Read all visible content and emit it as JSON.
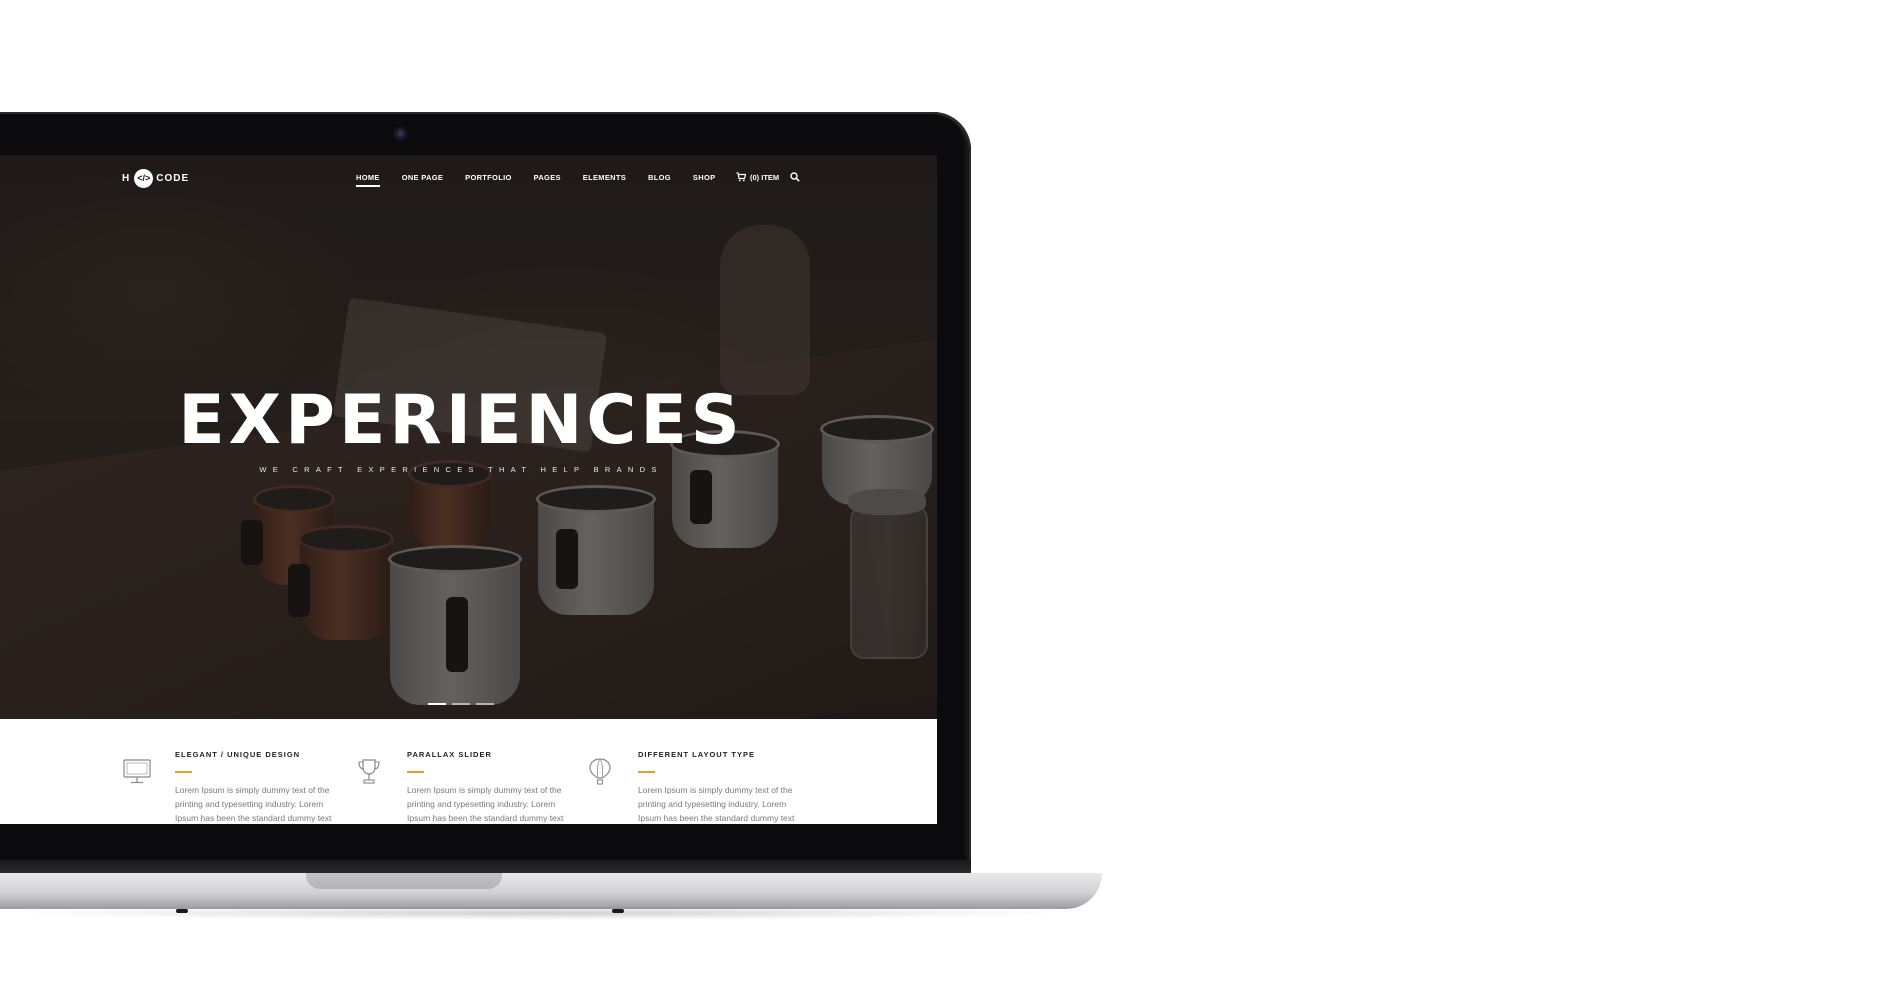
{
  "site": {
    "logo": {
      "left": "H",
      "mark": "</>",
      "right": "CODE"
    },
    "nav": [
      {
        "label": "HOME",
        "active": true
      },
      {
        "label": "ONE PAGE",
        "active": false
      },
      {
        "label": "PORTFOLIO",
        "active": false
      },
      {
        "label": "PAGES",
        "active": false
      },
      {
        "label": "ELEMENTS",
        "active": false
      },
      {
        "label": "BLOG",
        "active": false
      },
      {
        "label": "SHOP",
        "active": false
      }
    ],
    "cart_label": "(0) ITEM",
    "hero": {
      "title": "EXPERIENCES",
      "subtitle": "WE CRAFT EXPERIENCES THAT HELP BRANDS",
      "slides": 3,
      "active_slide": 1
    },
    "features": [
      {
        "icon": "monitor-icon",
        "title": "ELEGANT / UNIQUE DESIGN",
        "text": "Lorem Ipsum is simply dummy text of the printing and typesetting industry. Lorem Ipsum has been the standard dummy text"
      },
      {
        "icon": "trophy-icon",
        "title": "PARALLAX SLIDER",
        "text": "Lorem Ipsum is simply dummy text of the printing and typesetting industry. Lorem Ipsum has been the standard dummy text"
      },
      {
        "icon": "balloon-icon",
        "title": "DIFFERENT LAYOUT TYPE",
        "text": "Lorem Ipsum is simply dummy text of the printing and typesetting industry. Lorem Ipsum has been the standard dummy text"
      }
    ],
    "accent_color": "#e0a21f"
  }
}
